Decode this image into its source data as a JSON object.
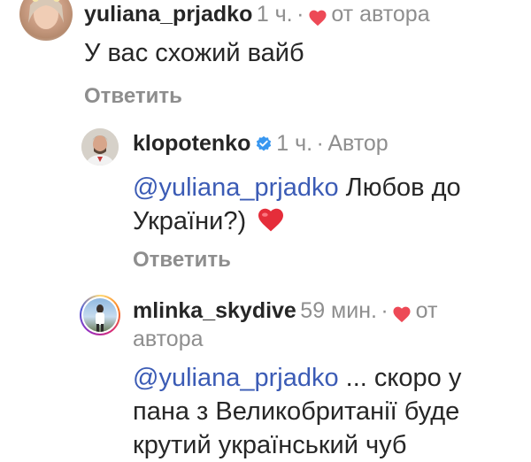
{
  "comments": [
    {
      "username": "yuliana_prjadko",
      "time": "1 ч.",
      "separator": "·",
      "badge": "от автора",
      "text": "У вас схожий вайб",
      "reply": "Ответить"
    },
    {
      "username": "klopotenko",
      "time": "1 ч.",
      "separator": "·",
      "badge": "Автор",
      "mention": "@yuliana_prjadko",
      "text_line1": "Любов до",
      "text_line2": "України?)",
      "emoji": "❤️",
      "reply": "Ответить"
    },
    {
      "username": "mlinka_skydive",
      "time": "59 мин.",
      "separator": "·",
      "badge_line1": "от",
      "badge_line2": "автора",
      "mention": "@yuliana_prjadko",
      "text_line1": "... скоро у",
      "text_line2": "пана з Великобританії буде",
      "text_line3": "крутий український чуб"
    }
  ],
  "colors": {
    "heart": "#ed4956",
    "verified": "#3897f0",
    "mention": "#3b5bb5",
    "meta": "#8e8e8e"
  }
}
